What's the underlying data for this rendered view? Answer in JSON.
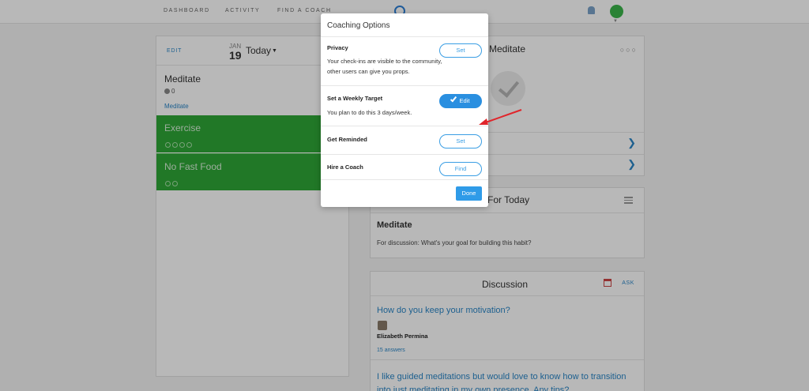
{
  "topnav": {
    "links": [
      "DASHBOARD",
      "ACTIVITY",
      "FIND A COACH"
    ]
  },
  "left_panel": {
    "edit": "EDIT",
    "month": "JAN",
    "day": "19",
    "today": "Today",
    "habits": [
      {
        "title": "Meditate",
        "count": "0",
        "link": "Meditate"
      },
      {
        "title": "Exercise"
      },
      {
        "title": "No Fast Food"
      }
    ]
  },
  "meditate_card": {
    "title": "Meditate",
    "dots": "○○○"
  },
  "fortoday_card": {
    "title": "For Today",
    "habit": "Meditate",
    "prompt": "For discussion: What's your goal for building this habit?"
  },
  "discussion_card": {
    "title": "Discussion",
    "ask": "ASK",
    "question1": "How do you keep your motivation?",
    "user": "Elizabeth Permina",
    "answers": "15 answers",
    "question2": "I like guided meditations but would love to know how to transition into just meditating in my own presence. Any tips?"
  },
  "modal": {
    "title": "Coaching Options",
    "options": [
      {
        "title": "Privacy",
        "desc": "Your check-ins are visible to the community, other users can give you props.",
        "button": "Set"
      },
      {
        "title": "Set a Weekly Target",
        "desc": "You plan to do this 3 days/week.",
        "button": "Edit"
      },
      {
        "title": "Get Reminded",
        "button": "Set"
      },
      {
        "title": "Hire a Coach",
        "button": "Find"
      }
    ],
    "done": "Done"
  },
  "colors": {
    "accent": "#2a8fe0",
    "habit_green": "#2ea737",
    "arrow_red": "#e0252b"
  }
}
